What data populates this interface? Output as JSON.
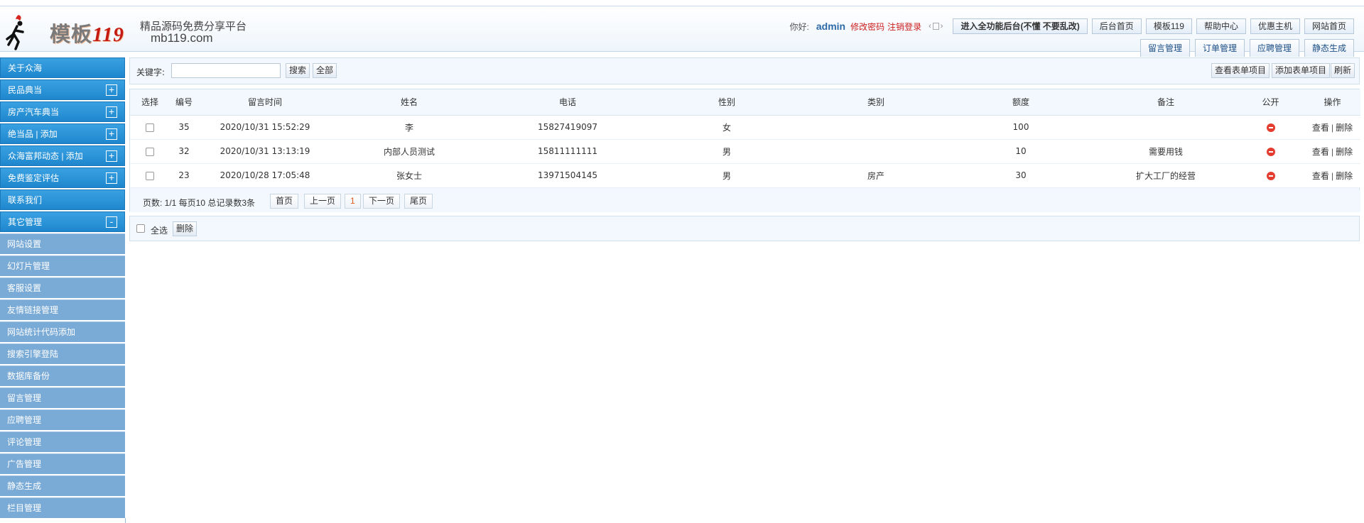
{
  "header": {
    "logo_text_a": "模板",
    "logo_text_b": "119",
    "slogan": "精品源码免费分享平台",
    "domain": "mb119.com",
    "greeting": "你好:",
    "username": "admin",
    "change_password": "修改密码",
    "logout": "注销登录",
    "top_buttons": [
      "进入全功能后台(不懂 不要乱改)",
      "后台首页",
      "模板119",
      "帮助中心",
      "优惠主机",
      "网站首页"
    ],
    "tabs": [
      "留言管理",
      "订单管理",
      "应聘管理",
      "静态生成"
    ]
  },
  "sidebar": {
    "items": [
      {
        "label": "关于众海",
        "style": "dark",
        "toggle": ""
      },
      {
        "label": "民品典当",
        "style": "dark",
        "toggle": "+"
      },
      {
        "label": "房产汽车典当",
        "style": "dark",
        "toggle": "+"
      },
      {
        "label": "绝当品 |   添加",
        "style": "dark",
        "toggle": "+"
      },
      {
        "label": "众海富邦动态 |   添加",
        "style": "dark",
        "toggle": "+"
      },
      {
        "label": "免费鉴定评估",
        "style": "dark",
        "toggle": "+"
      },
      {
        "label": "联系我们",
        "style": "dark",
        "toggle": ""
      },
      {
        "label": "其它管理",
        "style": "dark",
        "toggle": "-"
      },
      {
        "label": "网站设置",
        "style": "light",
        "toggle": ""
      },
      {
        "label": "幻灯片管理",
        "style": "light",
        "toggle": ""
      },
      {
        "label": "客服设置",
        "style": "light",
        "toggle": ""
      },
      {
        "label": "友情链接管理",
        "style": "light",
        "toggle": ""
      },
      {
        "label": "网站统计代码添加",
        "style": "light",
        "toggle": ""
      },
      {
        "label": "搜索引擎登陆",
        "style": "light",
        "toggle": ""
      },
      {
        "label": "数据库备份",
        "style": "light",
        "toggle": ""
      },
      {
        "label": "留言管理",
        "style": "light",
        "toggle": ""
      },
      {
        "label": "应聘管理",
        "style": "light",
        "toggle": ""
      },
      {
        "label": "评论管理",
        "style": "light",
        "toggle": ""
      },
      {
        "label": "广告管理",
        "style": "light",
        "toggle": ""
      },
      {
        "label": "静态生成",
        "style": "light",
        "toggle": ""
      },
      {
        "label": "栏目管理",
        "style": "light",
        "toggle": ""
      }
    ]
  },
  "search": {
    "label": "关键字:",
    "value": "",
    "search_btn": "搜索",
    "all_btn": "全部",
    "view_items_btn": "查看表单项目",
    "add_items_btn": "添加表单项目",
    "refresh_btn": "刷新"
  },
  "table": {
    "headers": [
      "选择",
      "编号",
      "留言时间",
      "姓名",
      "电话",
      "性别",
      "类别",
      "额度",
      "备注",
      "公开",
      "操作"
    ],
    "rows": [
      {
        "id": "35",
        "time": "2020/10/31 15:52:29",
        "name": "李",
        "phone": "15827419097",
        "gender": "女",
        "category": "",
        "amount": "100",
        "note": ""
      },
      {
        "id": "32",
        "time": "2020/10/31 13:13:19",
        "name": "内部人员测试",
        "phone": "15811111111",
        "gender": "男",
        "category": "",
        "amount": "10",
        "note": "需要用钱"
      },
      {
        "id": "23",
        "time": "2020/10/28 17:05:48",
        "name": "张女士",
        "phone": "13971504145",
        "gender": "男",
        "category": "房产",
        "amount": "30",
        "note": "扩大工厂的经营"
      }
    ],
    "op_view": "查看",
    "op_delete": "删除",
    "op_sep": "|"
  },
  "pager": {
    "info": "页数: 1/1 每页10 总记录数3条",
    "first": "首页",
    "prev": "上一页",
    "current": "1",
    "next": "下一页",
    "last": "尾页"
  },
  "bulk": {
    "select_all": "全选",
    "delete": "删除"
  },
  "colors": {
    "sidebar_dark": "#1f86cd",
    "sidebar_light": "#7aaad6",
    "accent_red": "#cc1e1e"
  }
}
